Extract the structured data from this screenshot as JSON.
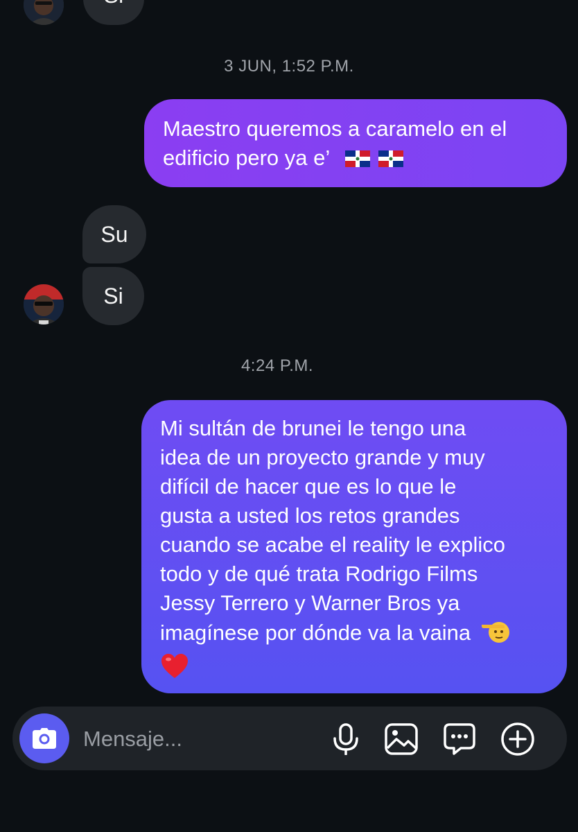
{
  "thread": {
    "timestamps": {
      "first": "3 JUN, 1:52 P.M.",
      "second": "4:24 P.M."
    },
    "top_partial_message": "Si",
    "outgoing_1": {
      "line1": "Maestro queremos a caramelo en el",
      "line2": "edificio pero ya e’",
      "emojis": [
        "dominican-flag",
        "dominican-flag"
      ]
    },
    "incoming": [
      {
        "text": "Su"
      },
      {
        "text": "Si"
      }
    ],
    "outgoing_2": {
      "lines": [
        "Mi sultán de brunei le tengo una",
        "idea de un proyecto grande y muy",
        "difícil de hacer que es lo que le",
        "gusta a usted los retos grandes",
        "cuando se acabe el reality le explico",
        "todo y de qué trata Rodrigo Films",
        "Jessy Terrero y Warner Bros ya",
        "imagínese por dónde va la vaina"
      ],
      "emojis": [
        "saluting-face",
        "red-heart"
      ]
    }
  },
  "composer": {
    "placeholder": "Mensaje...",
    "icons": [
      "camera-icon",
      "microphone-icon",
      "gallery-icon",
      "sticker-icon",
      "plus-icon"
    ]
  },
  "colors": {
    "background": "#0c1014",
    "incoming_bubble": "#262a2f",
    "outgoing_gradient_start": "#8a3cf0",
    "outgoing_gradient_end": "#5652f2",
    "accent": "#5b5cf0"
  }
}
